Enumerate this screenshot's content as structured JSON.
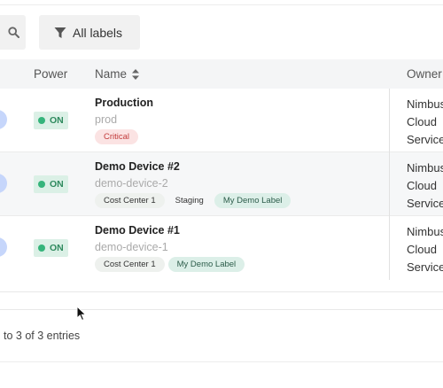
{
  "toolbar": {
    "search_icon": "search-icon",
    "filter_label": "All labels",
    "filter_icon": "filter-icon"
  },
  "table": {
    "headers": {
      "power": "Power",
      "name": "Name",
      "owner": "Owner"
    },
    "rows": [
      {
        "power": "ON",
        "name": "Production",
        "slug": "prod",
        "tags": [
          "Critical"
        ],
        "owner": [
          "Nimbus",
          "Cloud",
          "Service"
        ]
      },
      {
        "power": "ON",
        "name": "Demo Device #2",
        "slug": "demo-device-2",
        "tags": [
          "Cost Center 1",
          "Staging",
          "My Demo Label"
        ],
        "owner": [
          "Nimbus",
          "Cloud",
          "Service"
        ]
      },
      {
        "power": "ON",
        "name": "Demo Device #1",
        "slug": "demo-device-1",
        "tags": [
          "Cost Center 1",
          "My Demo Label"
        ],
        "owner": [
          "Nimbus",
          "Cloud",
          "Service"
        ]
      }
    ]
  },
  "footer": {
    "entries_text": "to 3 of 3 entries"
  },
  "colors": {
    "on_badge_bg": "#dbf0e6",
    "on_dot": "#35b47b",
    "critical_bg": "#fbe3e3",
    "critical_text": "#c23b3b",
    "demo_label_bg": "#dcefe8",
    "avatar": "#c6d6fb"
  }
}
